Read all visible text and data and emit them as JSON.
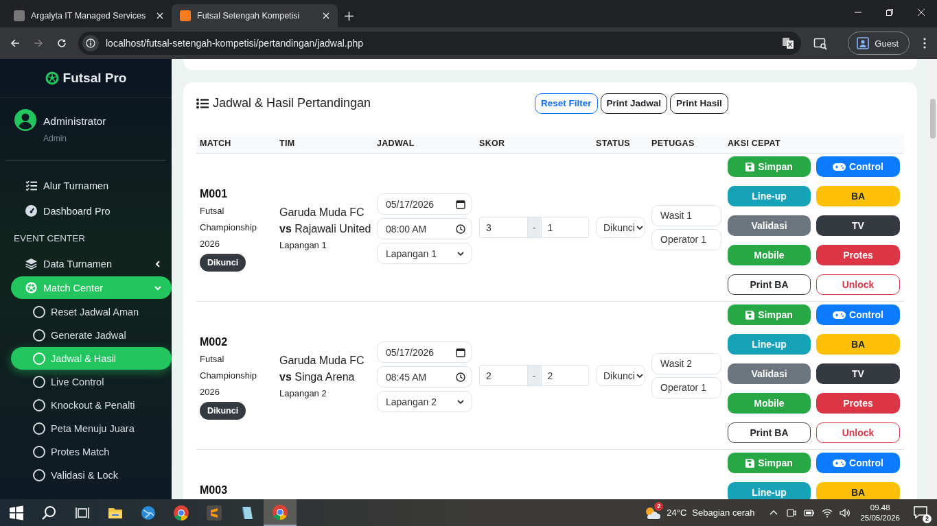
{
  "browser": {
    "tabs": [
      {
        "title": "Argalyta IT Managed Services",
        "selected": false
      },
      {
        "title": "Futsal Setengah Kompetisi",
        "selected": true
      }
    ],
    "url": "localhost/futsal-setengah-kompetisi/pertandingan/jadwal.php",
    "profile": "Guest"
  },
  "sidebar": {
    "brand": "Futsal Pro",
    "user": {
      "name": "Administrator",
      "role": "Admin"
    },
    "items": [
      {
        "kind": "link",
        "label": "Alur Turnamen"
      },
      {
        "kind": "link",
        "label": "Dashboard Pro"
      },
      {
        "kind": "section",
        "label": "EVENT CENTER"
      },
      {
        "kind": "group",
        "label": "Data Turnamen",
        "expanded": false,
        "selected": false
      },
      {
        "kind": "group",
        "label": "Match Center",
        "expanded": true,
        "selected": true,
        "children": [
          {
            "label": "Reset Jadwal Aman",
            "selected": false
          },
          {
            "label": "Generate Jadwal",
            "selected": false
          },
          {
            "label": "Jadwal & Hasil",
            "selected": true
          },
          {
            "label": "Live Control",
            "selected": false
          },
          {
            "label": "Knockout & Penalti",
            "selected": false
          },
          {
            "label": "Peta Menuju Juara",
            "selected": false
          },
          {
            "label": "Protes Match",
            "selected": false
          },
          {
            "label": "Validasi & Lock",
            "selected": false
          }
        ]
      }
    ]
  },
  "panel": {
    "title": "Jadwal & Hasil Pertandingan",
    "buttons": [
      {
        "label": "Reset Filter",
        "kind": "primary"
      },
      {
        "label": "Print Jadwal",
        "kind": "dark"
      },
      {
        "label": "Print Hasil",
        "kind": "dark"
      }
    ],
    "table": {
      "columns": [
        "MATCH",
        "TIM",
        "JADWAL",
        "SKOR",
        "STATUS",
        "PETUGAS",
        "AKSI CEPAT"
      ],
      "rows": [
        {
          "match": "M001",
          "event": "Futsal Championship 2026",
          "badge": "Dikunci",
          "team": "Garuda Muda FC",
          "opponent": "**vs** Rajawali United",
          "venue": "Lapangan 1",
          "date": "05/17/2026",
          "time": "08:00 AM",
          "field": "Lapangan 1",
          "score_home": "3",
          "score_sep": "-",
          "score_away": "1",
          "status": "Dikunci",
          "referee": "Wasit 1",
          "operator": "Operator 1",
          "actions": [
            {
              "label": "Simpan",
              "kind": "success"
            },
            {
              "label": "Control",
              "kind": "primary"
            },
            {
              "label": "Line-up",
              "kind": "info"
            },
            {
              "label": "BA",
              "kind": "warning"
            },
            {
              "label": "Validasi",
              "kind": "secondary"
            },
            {
              "label": "TV",
              "kind": "dark"
            },
            {
              "label": "Mobile",
              "kind": "success"
            },
            {
              "label": "Protes",
              "kind": "danger"
            },
            {
              "label": "Print BA",
              "kind": "outline-dark"
            },
            {
              "label": "Unlock",
              "kind": "outline-danger"
            }
          ]
        },
        {
          "match": "M002",
          "event": "Futsal Championship 2026",
          "badge": "Dikunci",
          "team": "Garuda Muda FC",
          "opponent": "**vs** Singa Arena",
          "venue": "Lapangan 2",
          "date": "05/17/2026",
          "time": "08:45 AM",
          "field": "Lapangan 2",
          "score_home": "2",
          "score_sep": "-",
          "score_away": "2",
          "status": "Dikunci",
          "referee": "Wasit 2",
          "operator": "Operator 1",
          "actions": [
            {
              "label": "Simpan",
              "kind": "success"
            },
            {
              "label": "Control",
              "kind": "primary"
            },
            {
              "label": "Line-up",
              "kind": "info"
            },
            {
              "label": "BA",
              "kind": "warning"
            },
            {
              "label": "Validasi",
              "kind": "secondary"
            },
            {
              "label": "TV",
              "kind": "dark"
            },
            {
              "label": "Mobile",
              "kind": "success"
            },
            {
              "label": "Protes",
              "kind": "danger"
            },
            {
              "label": "Print BA",
              "kind": "outline-dark"
            },
            {
              "label": "Unlock",
              "kind": "outline-danger"
            }
          ]
        },
        {
          "match": "M003",
          "actions": [
            {
              "label": "Simpan",
              "kind": "success"
            },
            {
              "label": "Control",
              "kind": "primary"
            },
            {
              "label": "Line-up",
              "kind": "info"
            },
            {
              "label": "BA",
              "kind": "warning"
            }
          ]
        }
      ]
    }
  },
  "taskbar": {
    "weather_badge": "2",
    "temperature": "24°C",
    "weather": "Sebagian cerah",
    "time": "09.48",
    "date": "25/05/2026",
    "notifications": "2"
  }
}
